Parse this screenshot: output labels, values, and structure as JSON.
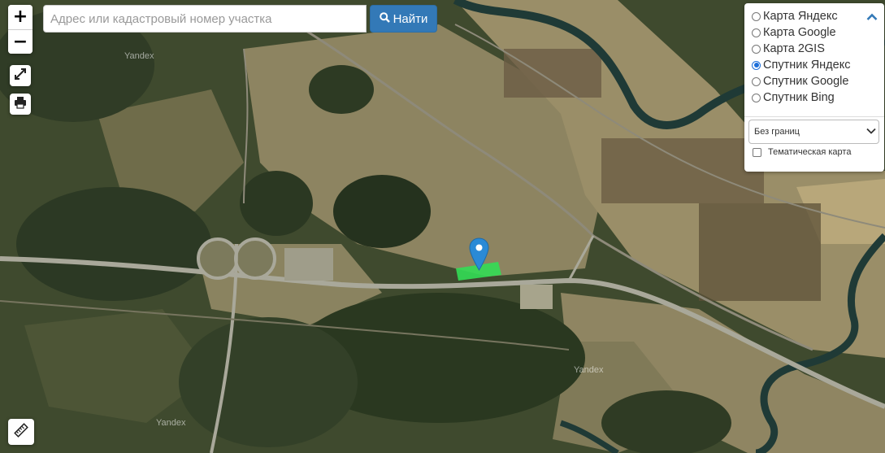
{
  "search": {
    "placeholder": "Адрес или кадастровый номер участка",
    "button_label": "Найти"
  },
  "zoom": {
    "in_label": "+",
    "out_label": "−"
  },
  "tools": [
    "fullscreen-icon",
    "print-icon",
    "ruler-icon"
  ],
  "layers": {
    "options": [
      {
        "label": "Карта Яндекс",
        "selected": false
      },
      {
        "label": "Карта Google",
        "selected": false
      },
      {
        "label": "Карта 2GIS",
        "selected": false
      },
      {
        "label": "Спутник Яндекс",
        "selected": true
      },
      {
        "label": "Спутник Google",
        "selected": false
      },
      {
        "label": "Спутник Bing",
        "selected": false
      }
    ],
    "borders_select": "Без границ",
    "thematic_label": "Тематическая карта",
    "thematic_checked": false
  },
  "watermark": "Yandex",
  "colors": {
    "accent": "#3379b7",
    "marker": "#2a8ad6",
    "parcel": "#33dd55",
    "radio_selected": "#1e6fd9"
  }
}
